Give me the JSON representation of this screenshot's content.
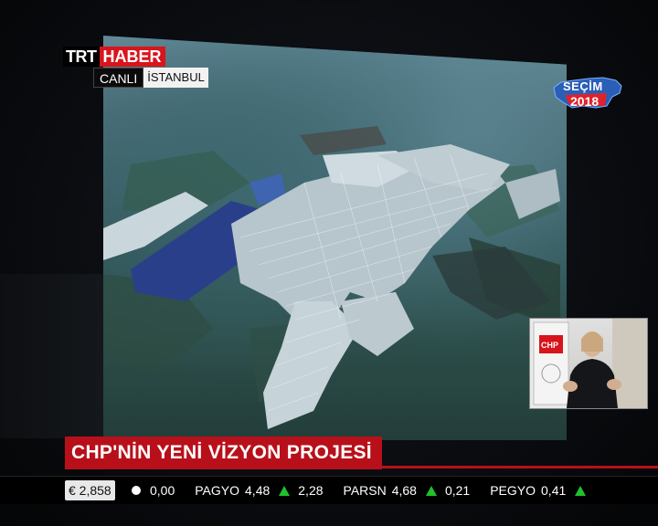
{
  "logo": {
    "brand_a": "TRT",
    "brand_b": "HABER"
  },
  "live": {
    "label": "CANLI",
    "city": "İSTANBUL"
  },
  "election_badge": {
    "title": "SEÇİM",
    "year": "2018"
  },
  "inset": {
    "party_logo_text": "CHP"
  },
  "headline": {
    "text": "CHP'NİN YENİ VİZYON PROJESİ"
  },
  "ticker": {
    "currency": "€ 2,858",
    "items": [
      {
        "symbol": "",
        "price": "",
        "indicator": "dot",
        "change": "0,00"
      },
      {
        "symbol": "PAGYO",
        "price": "4,48",
        "indicator": "up",
        "change": "2,28"
      },
      {
        "symbol": "PARSN",
        "price": "4,68",
        "indicator": "up",
        "change": "0,21"
      },
      {
        "symbol": "PEGYO",
        "price": "0,41",
        "indicator": "up",
        "change": ""
      }
    ]
  },
  "colors": {
    "brand_red": "#d8141c",
    "headline_red": "#b8101a",
    "ticker_up": "#1fc12c"
  }
}
